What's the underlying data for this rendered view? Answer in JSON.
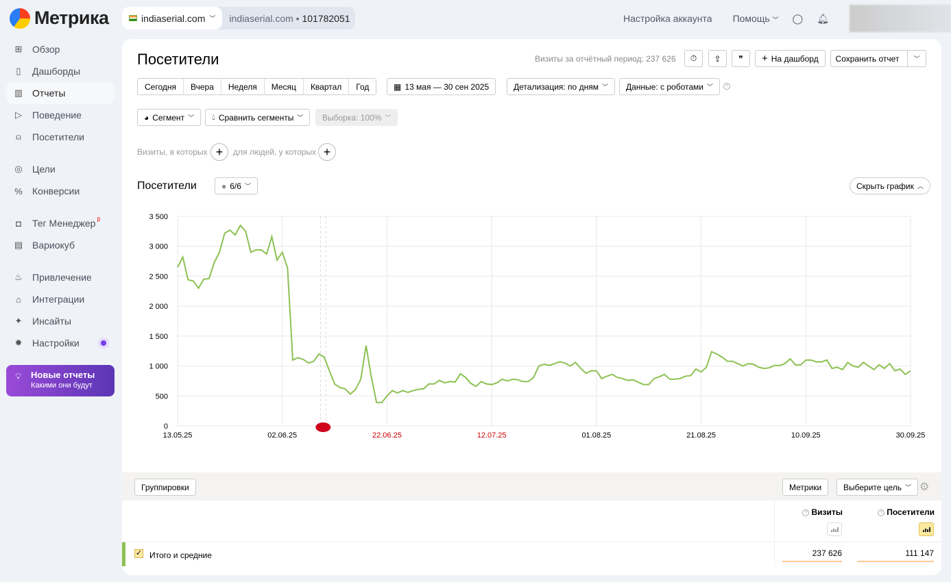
{
  "app": {
    "logo": "Метрика"
  },
  "counter": {
    "site": "indiaserial.com",
    "site2": "indiaserial.com",
    "id": "101782051"
  },
  "topnav": {
    "account": "Настройка аккаунта",
    "help": "Помощь"
  },
  "sidebar": {
    "items": [
      {
        "label": "Обзор",
        "icon": "grid-icon"
      },
      {
        "label": "Дашборды",
        "icon": "dashboard-icon"
      },
      {
        "label": "Отчеты",
        "icon": "reports-icon",
        "active": true
      },
      {
        "label": "Поведение",
        "icon": "play-icon"
      },
      {
        "label": "Посетители",
        "icon": "user-icon"
      },
      {
        "label": "Цели",
        "icon": "target-icon"
      },
      {
        "label": "Конверсии",
        "icon": "percent-icon"
      },
      {
        "label": "Тег Менеджер",
        "icon": "tag-manager-icon",
        "badge": "β"
      },
      {
        "label": "Вариокуб",
        "icon": "variocube-icon"
      },
      {
        "label": "Привлечение",
        "icon": "fire-icon"
      },
      {
        "label": "Интеграции",
        "icon": "puzzle-icon"
      },
      {
        "label": "Инсайты",
        "icon": "sparkle-icon"
      },
      {
        "label": "Настройки",
        "icon": "gear-icon"
      }
    ],
    "promo": {
      "title": "Новые отчеты",
      "subtitle": "Какими они будут"
    }
  },
  "header": {
    "title": "Посетители",
    "visits_label": "Визиты за отчётный период: 237 626",
    "to_dashboard": "На дашборд",
    "save": "Сохранить отчет"
  },
  "periods": [
    "Сегодня",
    "Вчера",
    "Неделя",
    "Месяц",
    "Квартал",
    "Год"
  ],
  "date_range": "13 мая — 30 сен 2025",
  "detail": "Детализация: по дням",
  "data_mode": "Данные: с роботами",
  "segment": "Сегмент",
  "compare": "Сравнить сегменты",
  "sample": "Выборка: 100%",
  "filters": {
    "visits": "Визиты, в которых",
    "people": "для людей, у которых"
  },
  "chart_header": {
    "title": "Посетители",
    "counter": "6/6",
    "hide": "Скрыть график"
  },
  "chart_data": {
    "type": "line",
    "color": "#8cc152",
    "ylim": [
      0,
      3500
    ],
    "yticks": [
      "0",
      "500",
      "1 000",
      "1 500",
      "2 000",
      "2 500",
      "3 000",
      "3 500"
    ],
    "xticks": [
      {
        "label": "13.05.25",
        "holiday": false
      },
      {
        "label": "02.06.25",
        "holiday": false
      },
      {
        "label": "22.06.25",
        "holiday": true
      },
      {
        "label": "12.07.25",
        "holiday": true
      },
      {
        "label": "01.08.25",
        "holiday": false
      },
      {
        "label": "21.08.25",
        "holiday": false
      },
      {
        "label": "10.09.25",
        "holiday": false
      },
      {
        "label": "30.09.25",
        "holiday": false
      }
    ],
    "x_start": "2025-05-13",
    "x_end": "2025-09-30",
    "grid": true,
    "values": [
      2650,
      2820,
      2440,
      2420,
      2300,
      2450,
      2460,
      2730,
      2900,
      3220,
      3270,
      3190,
      3350,
      3250,
      2900,
      2940,
      2940,
      2870,
      3160,
      2770,
      2900,
      2640,
      1100,
      1140,
      1110,
      1050,
      1080,
      1200,
      1150,
      920,
      700,
      640,
      620,
      530,
      610,
      780,
      1340,
      820,
      390,
      390,
      500,
      590,
      550,
      590,
      560,
      590,
      610,
      620,
      700,
      700,
      760,
      720,
      740,
      730,
      870,
      810,
      710,
      660,
      740,
      700,
      690,
      720,
      780,
      750,
      780,
      770,
      740,
      740,
      810,
      1000,
      1030,
      1010,
      1040,
      1070,
      1050,
      1000,
      1060,
      960,
      880,
      920,
      920,
      790,
      830,
      860,
      810,
      790,
      760,
      770,
      730,
      690,
      690,
      790,
      820,
      860,
      780,
      780,
      790,
      830,
      840,
      950,
      900,
      980,
      1240,
      1200,
      1150,
      1080,
      1080,
      1040,
      1000,
      1040,
      1030,
      980,
      960,
      970,
      1010,
      1010,
      1040,
      1120,
      1020,
      1020,
      1100,
      1100,
      1070,
      1070,
      1100,
      960,
      980,
      940,
      1060,
      1000,
      980,
      1060,
      1000,
      940,
      1020,
      960,
      1040,
      920,
      950,
      860,
      920
    ]
  },
  "table": {
    "groupings": "Группировки",
    "metrics": "Метрики",
    "goal": "Выберите цель",
    "col_visits": "Визиты",
    "col_visitors": "Посетители",
    "total_label": "Итого и средние",
    "total_visits": "237 626",
    "total_visitors": "111 147"
  }
}
